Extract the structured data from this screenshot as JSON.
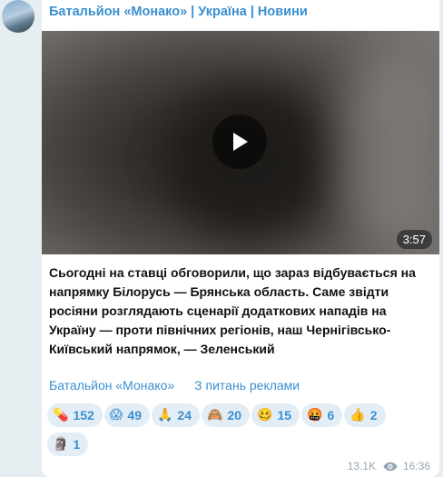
{
  "message": {
    "channel_name": "Батальйон «Монако» | Україна | Новини",
    "video_duration": "3:57",
    "text": "Сьогодні на ставці обговорили, що зараз відбувається на напрямку Білорусь — Брянська область. Саме звідти росіяни розглядають сценарії додаткових нападів на Україну — проти північних регіонів, наш Чернігівсько-Київський напрямок, — Зеленський",
    "links": [
      "Батальйон «Монако»",
      "З питань реклами"
    ],
    "reactions": [
      {
        "icon": "pill-icon",
        "emoji": "💊",
        "count": "152"
      },
      {
        "icon": "screaming-face-icon",
        "emoji": "😱",
        "count": "49"
      },
      {
        "icon": "folded-hands-icon",
        "emoji": "🙏",
        "count": "24"
      },
      {
        "icon": "see-no-evil-monkey-icon",
        "emoji": "🙈",
        "count": "20"
      },
      {
        "icon": "woozy-face-icon",
        "emoji": "🥴",
        "count": "15"
      },
      {
        "icon": "cursing-face-icon",
        "emoji": "🤬",
        "count": "6"
      },
      {
        "icon": "thumbs-up-icon",
        "emoji": "👍",
        "count": "2"
      },
      {
        "icon": "moai-icon",
        "emoji": "🗿",
        "count": "1"
      }
    ],
    "views": "13.1K",
    "time": "16:36"
  },
  "colors": {
    "background": "#e7eef2",
    "accent": "#3a8fd0",
    "reaction_bg": "#e3edf6",
    "meta": "#98a6b3"
  }
}
